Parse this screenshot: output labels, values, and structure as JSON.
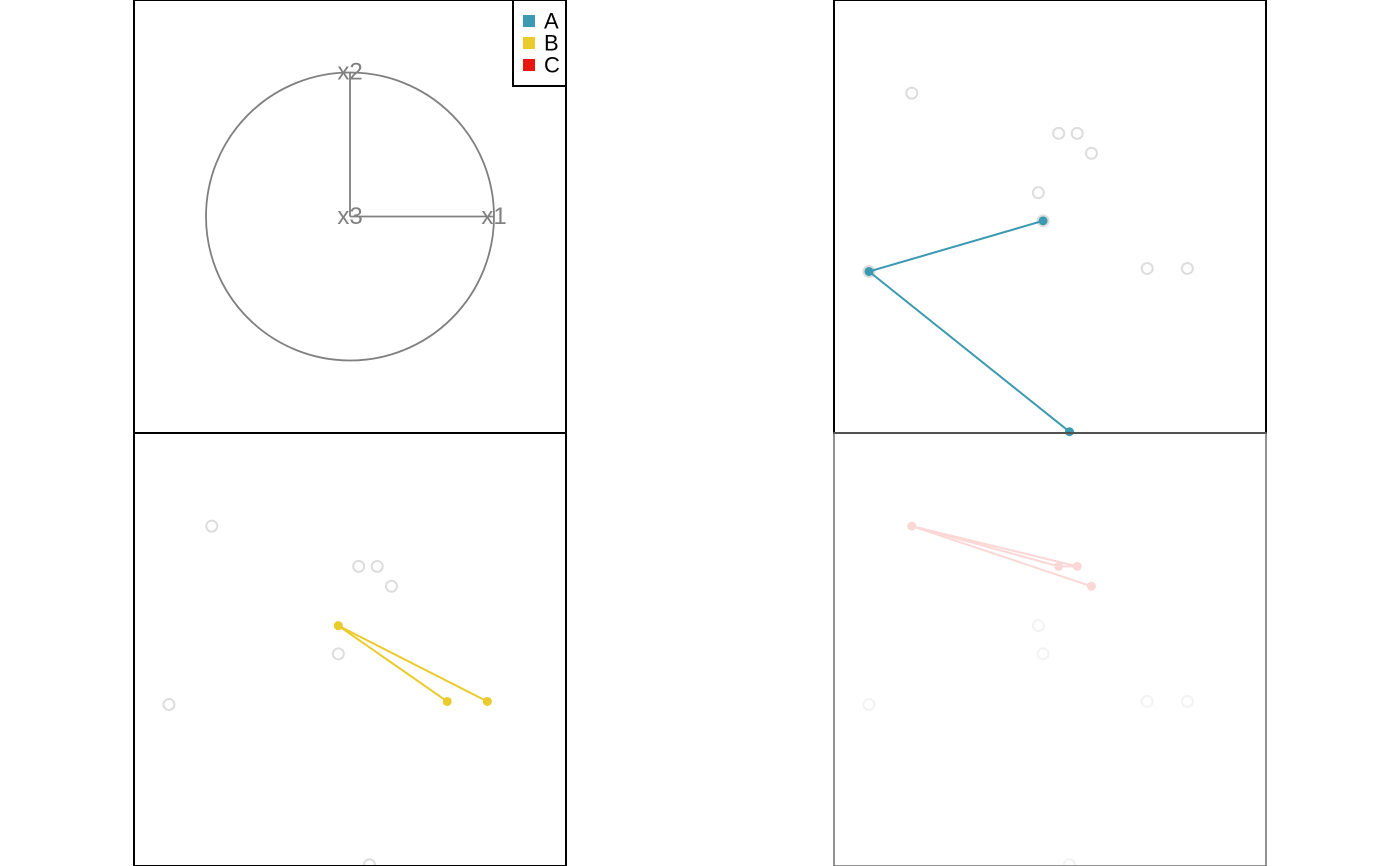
{
  "chart_data": [
    {
      "type": "line",
      "role": "projection-axes",
      "axes": [
        {
          "name": "x1",
          "x": 1,
          "y": 0
        },
        {
          "name": "x2",
          "x": 0,
          "y": 1
        },
        {
          "name": "x3",
          "x": 0,
          "y": 0
        }
      ],
      "circle_radius": 1,
      "xlim": [
        -1.5,
        1.5
      ],
      "ylim": [
        -1.5,
        1.5
      ],
      "axis_color": "#808080",
      "legend": {
        "placement": "top-right",
        "entries": [
          {
            "label": "A",
            "color": "#3B99B1"
          },
          {
            "label": "B",
            "color": "#EACB2B"
          },
          {
            "label": "C",
            "color": "#E8170F"
          }
        ]
      }
    },
    {
      "type": "scatter",
      "highlight_group": "A",
      "xlim": [
        0,
        1
      ],
      "ylim": [
        0,
        1
      ],
      "background_points": [
        {
          "x": 0.18,
          "y": 0.785
        },
        {
          "x": 0.52,
          "y": 0.692
        },
        {
          "x": 0.563,
          "y": 0.692
        },
        {
          "x": 0.596,
          "y": 0.646
        },
        {
          "x": 0.473,
          "y": 0.555
        },
        {
          "x": 0.484,
          "y": 0.49
        },
        {
          "x": 0.081,
          "y": 0.373
        },
        {
          "x": 0.725,
          "y": 0.38
        },
        {
          "x": 0.818,
          "y": 0.38
        }
      ],
      "group_points": [
        {
          "x": 0.484,
          "y": 0.49
        },
        {
          "x": 0.081,
          "y": 0.373
        },
        {
          "x": 0.545,
          "y": 0.003
        }
      ],
      "edges": [
        [
          0,
          1
        ],
        [
          1,
          2
        ]
      ],
      "color": "#3B99B1",
      "background_color": "#DDDDDD"
    },
    {
      "type": "scatter",
      "highlight_group": "B",
      "xlim": [
        0,
        1
      ],
      "ylim": [
        0,
        1
      ],
      "background_points": [
        {
          "x": 0.18,
          "y": 0.785
        },
        {
          "x": 0.52,
          "y": 0.692
        },
        {
          "x": 0.563,
          "y": 0.692
        },
        {
          "x": 0.596,
          "y": 0.646
        },
        {
          "x": 0.473,
          "y": 0.49
        },
        {
          "x": 0.081,
          "y": 0.373
        },
        {
          "x": 0.545,
          "y": 0.003
        }
      ],
      "group_points": [
        {
          "x": 0.473,
          "y": 0.555
        },
        {
          "x": 0.725,
          "y": 0.38
        },
        {
          "x": 0.818,
          "y": 0.38
        }
      ],
      "edges": [
        [
          0,
          1
        ],
        [
          0,
          2
        ]
      ],
      "color": "#EACB2B",
      "background_color": "#DDDDDD"
    },
    {
      "type": "scatter",
      "highlight_group": "C",
      "faded": true,
      "xlim": [
        0,
        1
      ],
      "ylim": [
        0,
        1
      ],
      "background_points": [
        {
          "x": 0.473,
          "y": 0.555
        },
        {
          "x": 0.484,
          "y": 0.49
        },
        {
          "x": 0.081,
          "y": 0.373
        },
        {
          "x": 0.725,
          "y": 0.38
        },
        {
          "x": 0.818,
          "y": 0.38
        },
        {
          "x": 0.545,
          "y": 0.003
        }
      ],
      "group_points": [
        {
          "x": 0.18,
          "y": 0.785
        },
        {
          "x": 0.52,
          "y": 0.692
        },
        {
          "x": 0.563,
          "y": 0.692
        },
        {
          "x": 0.596,
          "y": 0.646
        }
      ],
      "edges": [
        [
          0,
          1
        ],
        [
          0,
          2
        ],
        [
          0,
          3
        ],
        [
          1,
          2
        ]
      ],
      "color": "#FBD7D6",
      "background_color": "#F3F3F3"
    }
  ]
}
